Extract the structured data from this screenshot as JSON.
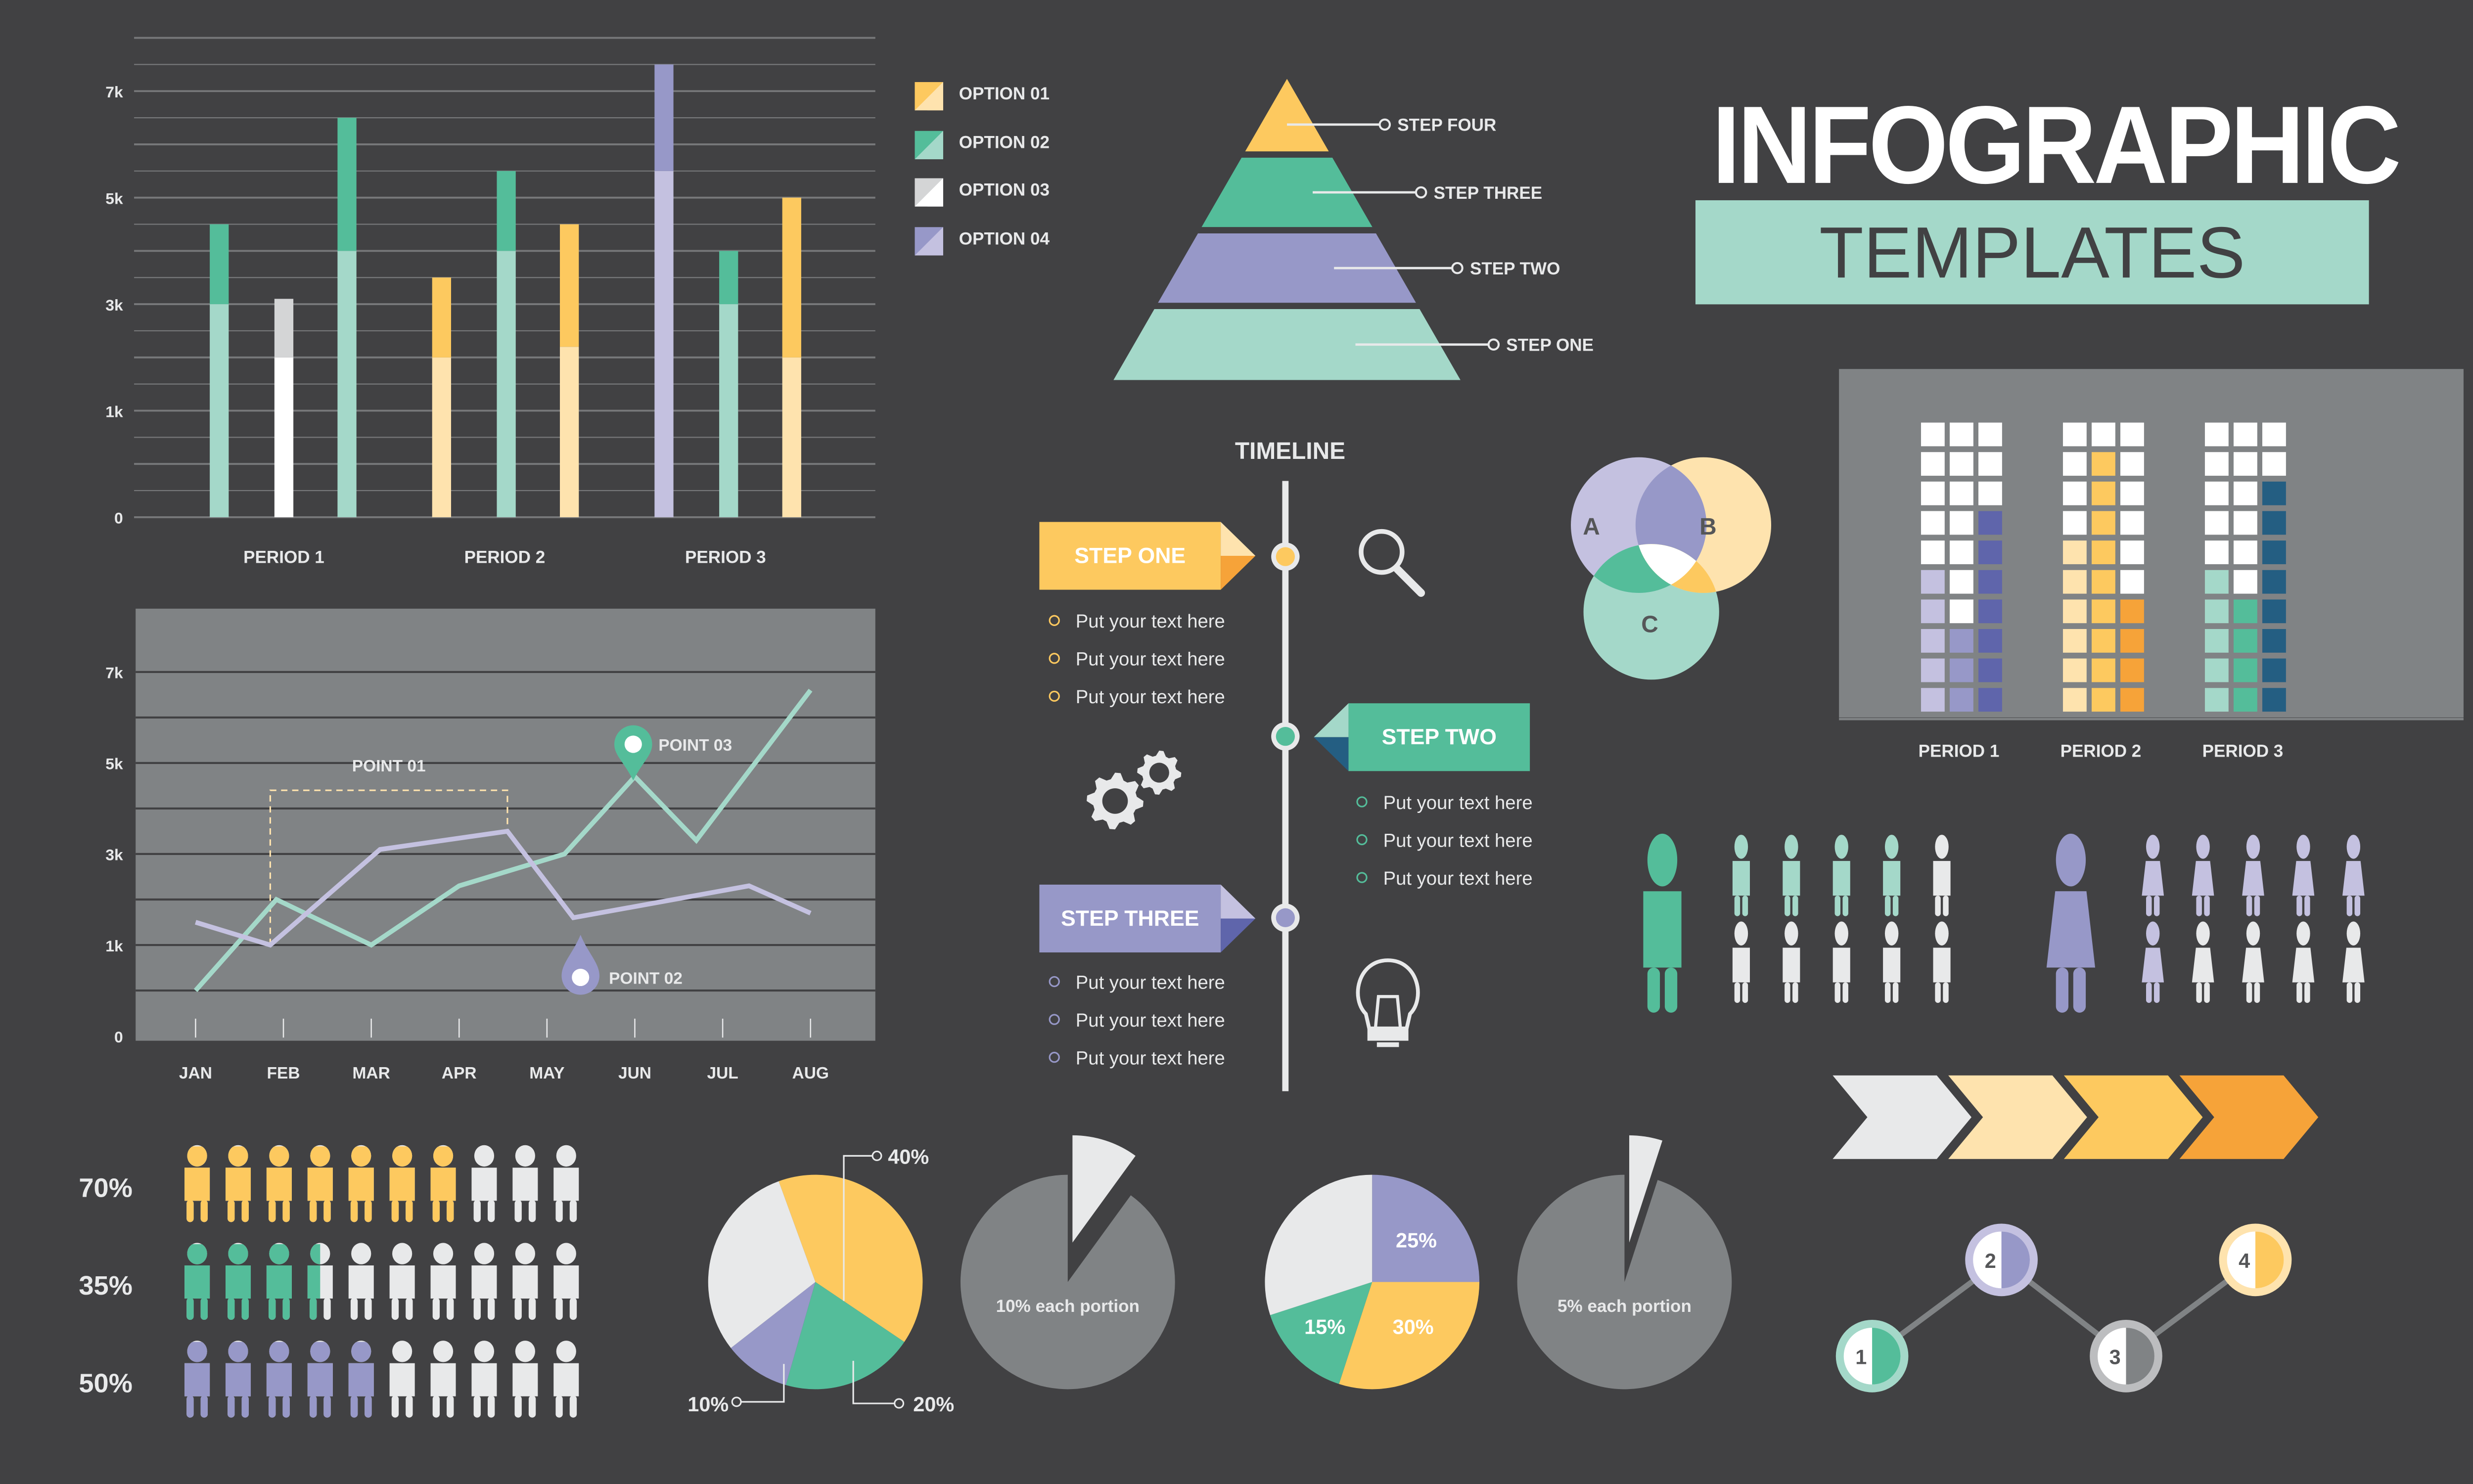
{
  "header": {
    "title": "INFOGRAPHIC",
    "subtitle": "TEMPLATES"
  },
  "colors": {
    "background": "#414143",
    "panel_gray": "#808385",
    "yellow": "#fdc95f",
    "yellow_light": "#fee3ae",
    "orange": "#f6a339",
    "green": "#54bd9a",
    "mint": "#a4d8c9",
    "purple": "#9798c8",
    "purple_light": "#c4c1e0",
    "indigo": "#5f65ab",
    "navy": "#245e82",
    "white": "#ffffff",
    "off_white": "#e8e9ea",
    "silver": "#d4d5d6"
  },
  "legend": {
    "items": [
      {
        "label": "OPTION 01",
        "color_dark": "#fdc95f",
        "color_light": "#fee3ae"
      },
      {
        "label": "OPTION 02",
        "color_dark": "#54bd9a",
        "color_light": "#a4d8c9"
      },
      {
        "label": "OPTION 03",
        "color_dark": "#d4d5d6",
        "color_light": "#ffffff"
      },
      {
        "label": "OPTION 04",
        "color_dark": "#9798c8",
        "color_light": "#c4c1e0"
      }
    ]
  },
  "pyramid": {
    "steps": [
      {
        "label": "STEP FOUR",
        "color": "#fdc95f"
      },
      {
        "label": "STEP THREE",
        "color": "#54bd9a"
      },
      {
        "label": "STEP TWO",
        "color": "#9798c8"
      },
      {
        "label": "STEP ONE",
        "color": "#a4d8c9"
      }
    ]
  },
  "timeline": {
    "title": "TIMELINE",
    "steps": [
      {
        "label": "STEP ONE",
        "color": "#fdc95f",
        "fold_light": "#fee3ae",
        "fold_dark": "#f6a339",
        "icon": "magnifier-icon",
        "items": [
          "Put your text here",
          "Put your text here",
          "Put your text here"
        ]
      },
      {
        "label": "STEP TWO",
        "color": "#54bd9a",
        "fold_light": "#a4d8c9",
        "fold_dark": "#245e82",
        "icon": "gears-icon",
        "items": [
          "Put your text here",
          "Put your text here",
          "Put your text here"
        ]
      },
      {
        "label": "STEP THREE",
        "color": "#9798c8",
        "fold_light": "#c4c1e0",
        "fold_dark": "#5f65ab",
        "icon": "lightbulb-icon",
        "items": [
          "Put your text here",
          "Put your text here",
          "Put your text here"
        ]
      }
    ]
  },
  "venn": {
    "sets": [
      "A",
      "B",
      "C"
    ]
  },
  "male_female": {
    "male": {
      "filled": 4,
      "total": 10,
      "color": "#a4d8c9",
      "big_color": "#54bd9a"
    },
    "female": {
      "filled": 6,
      "total": 10,
      "color": "#c4c1e0",
      "big_color": "#9798c8"
    }
  },
  "chevron_process": {
    "steps": 4,
    "colors": [
      "#e8e9ea",
      "#fee3ae",
      "#fdc95f",
      "#f6a339"
    ]
  },
  "numbered_path": {
    "nodes": [
      {
        "label": "1",
        "ring": "#a4d8c9",
        "fill": "#54bd9a"
      },
      {
        "label": "2",
        "ring": "#c4c1e0",
        "fill": "#9798c8"
      },
      {
        "label": "3",
        "ring": "#bcbdbf",
        "fill": "#808385"
      },
      {
        "label": "4",
        "ring": "#fee3ae",
        "fill": "#fdc95f"
      }
    ]
  },
  "chart_data": [
    {
      "id": "stacked-bars",
      "type": "bar",
      "title": "",
      "xlabel": "",
      "ylabel": "",
      "y_tick_labels": [
        "0",
        "1k",
        "3k",
        "5k",
        "7k"
      ],
      "y_tick_positions": [
        0,
        2,
        4,
        6,
        8
      ],
      "ylim": [
        0,
        9
      ],
      "grid": true,
      "categories": [
        "PERIOD 1",
        "PERIOD 2",
        "PERIOD 3"
      ],
      "bars": [
        {
          "period": "PERIOD 1",
          "base": 4.0,
          "top": 5.5,
          "base_color": "#a4d8c9",
          "top_color": "#54bd9a"
        },
        {
          "period": "PERIOD 1",
          "base": 3.0,
          "top": 4.1,
          "base_color": "#ffffff",
          "top_color": "#d4d5d6"
        },
        {
          "period": "PERIOD 1",
          "base": 5.0,
          "top": 7.5,
          "base_color": "#a4d8c9",
          "top_color": "#54bd9a"
        },
        {
          "period": "PERIOD 2",
          "base": 3.0,
          "top": 4.5,
          "base_color": "#fee3ae",
          "top_color": "#fdc95f"
        },
        {
          "period": "PERIOD 2",
          "base": 5.0,
          "top": 6.5,
          "base_color": "#a4d8c9",
          "top_color": "#54bd9a"
        },
        {
          "period": "PERIOD 2",
          "base": 3.2,
          "top": 5.5,
          "base_color": "#fee3ae",
          "top_color": "#fdc95f"
        },
        {
          "period": "PERIOD 3",
          "base": 6.5,
          "top": 8.5,
          "base_color": "#c4c1e0",
          "top_color": "#9798c8"
        },
        {
          "period": "PERIOD 3",
          "base": 4.0,
          "top": 5.0,
          "base_color": "#a4d8c9",
          "top_color": "#54bd9a"
        },
        {
          "period": "PERIOD 3",
          "base": 3.0,
          "top": 6.0,
          "base_color": "#fee3ae",
          "top_color": "#fdc95f"
        }
      ]
    },
    {
      "id": "line-chart",
      "type": "line",
      "title": "",
      "x": [
        "JAN",
        "FEB",
        "MAR",
        "APR",
        "MAY",
        "JUN",
        "JUL",
        "AUG"
      ],
      "y_tick_labels": [
        "0",
        "1k",
        "3k",
        "5k",
        "7k"
      ],
      "y_tick_positions": [
        0,
        2,
        4,
        6,
        8
      ],
      "ylim": [
        0,
        9
      ],
      "grid": true,
      "series": [
        {
          "name": "green",
          "color": "#a4d8c9",
          "points": [
            [
              0,
              1.0
            ],
            [
              0.92,
              3.0
            ],
            [
              2.0,
              2.0
            ],
            [
              3.0,
              3.3
            ],
            [
              4.2,
              4.0
            ],
            [
              5.0,
              5.7
            ],
            [
              5.7,
              4.3
            ],
            [
              7.0,
              7.6
            ]
          ]
        },
        {
          "name": "purple",
          "color": "#c4c1e0",
          "points": [
            [
              0,
              2.5
            ],
            [
              0.85,
              2.0
            ],
            [
              2.1,
              4.1
            ],
            [
              3.55,
              4.5
            ],
            [
              4.3,
              2.6
            ],
            [
              6.3,
              3.3
            ],
            [
              7.0,
              2.7
            ]
          ]
        }
      ],
      "annotations": [
        {
          "label": "POINT 01",
          "type": "dashed-box",
          "x_range": [
            0.85,
            3.55
          ],
          "y_top": 5.4,
          "color": "#fee3ae"
        },
        {
          "label": "POINT 02",
          "type": "pin-down",
          "x": 4.4,
          "y": 1.6,
          "color": "#9798c8"
        },
        {
          "label": "POINT 03",
          "type": "pin-up",
          "x": 5.0,
          "y": 6.1,
          "color": "#54bd9a"
        }
      ]
    },
    {
      "id": "waffle-chart",
      "type": "bar",
      "title": "",
      "categories": [
        "PERIOD 1",
        "PERIOD 2",
        "PERIOD 3"
      ],
      "rows": 10,
      "series": [
        {
          "period": "PERIOD 1",
          "columns": [
            {
              "filled": 5,
              "color": "#c4c1e0"
            },
            {
              "filled": 3,
              "color": "#9798c8"
            },
            {
              "filled": 7,
              "color": "#5f65ab"
            }
          ]
        },
        {
          "period": "PERIOD 2",
          "columns": [
            {
              "filled": 6,
              "color": "#fee3ae"
            },
            {
              "filled": 9,
              "color": "#fdc95f"
            },
            {
              "filled": 4,
              "color": "#f6a339"
            }
          ]
        },
        {
          "period": "PERIOD 3",
          "columns": [
            {
              "filled": 5,
              "color": "#a4d8c9"
            },
            {
              "filled": 4,
              "color": "#54bd9a"
            },
            {
              "filled": 8,
              "color": "#245e82"
            }
          ]
        }
      ]
    },
    {
      "id": "people-percent",
      "type": "bar",
      "title": "",
      "rows": [
        {
          "label": "70%",
          "value": 70,
          "color": "#fdc95f"
        },
        {
          "label": "35%",
          "value": 35,
          "color": "#54bd9a"
        },
        {
          "label": "50%",
          "value": 50,
          "color": "#9798c8"
        }
      ],
      "icons_per_row": 10
    },
    {
      "id": "pie-1",
      "type": "pie",
      "slices": [
        {
          "label": "40%",
          "value": 40,
          "color": "#fdc95f"
        },
        {
          "label": "20%",
          "value": 20,
          "color": "#54bd9a"
        },
        {
          "label": "10%",
          "value": 10,
          "color": "#9798c8"
        },
        {
          "label": "",
          "value": 30,
          "color": "#e8e9ea"
        }
      ],
      "start_angle_deg": -20
    },
    {
      "id": "pie-2",
      "type": "pie",
      "center_label": "10% each portion",
      "slices": [
        {
          "label": "",
          "value": 10,
          "color": "#e8e9ea",
          "exploded": true
        },
        {
          "label": "",
          "value": 90,
          "color": "#808385"
        }
      ],
      "start_angle_deg": 0
    },
    {
      "id": "pie-3",
      "type": "pie",
      "slices": [
        {
          "label": "25%",
          "value": 25,
          "color": "#9798c8"
        },
        {
          "label": "30%",
          "value": 30,
          "color": "#fdc95f"
        },
        {
          "label": "15%",
          "value": 15,
          "color": "#54bd9a"
        },
        {
          "label": "",
          "value": 30,
          "color": "#e8e9ea"
        }
      ],
      "start_angle_deg": 0
    },
    {
      "id": "pie-4",
      "type": "pie",
      "center_label": "5% each portion",
      "slices": [
        {
          "label": "",
          "value": 5,
          "color": "#e8e9ea",
          "exploded": true
        },
        {
          "label": "",
          "value": 95,
          "color": "#808385"
        }
      ],
      "start_angle_deg": 0
    }
  ]
}
